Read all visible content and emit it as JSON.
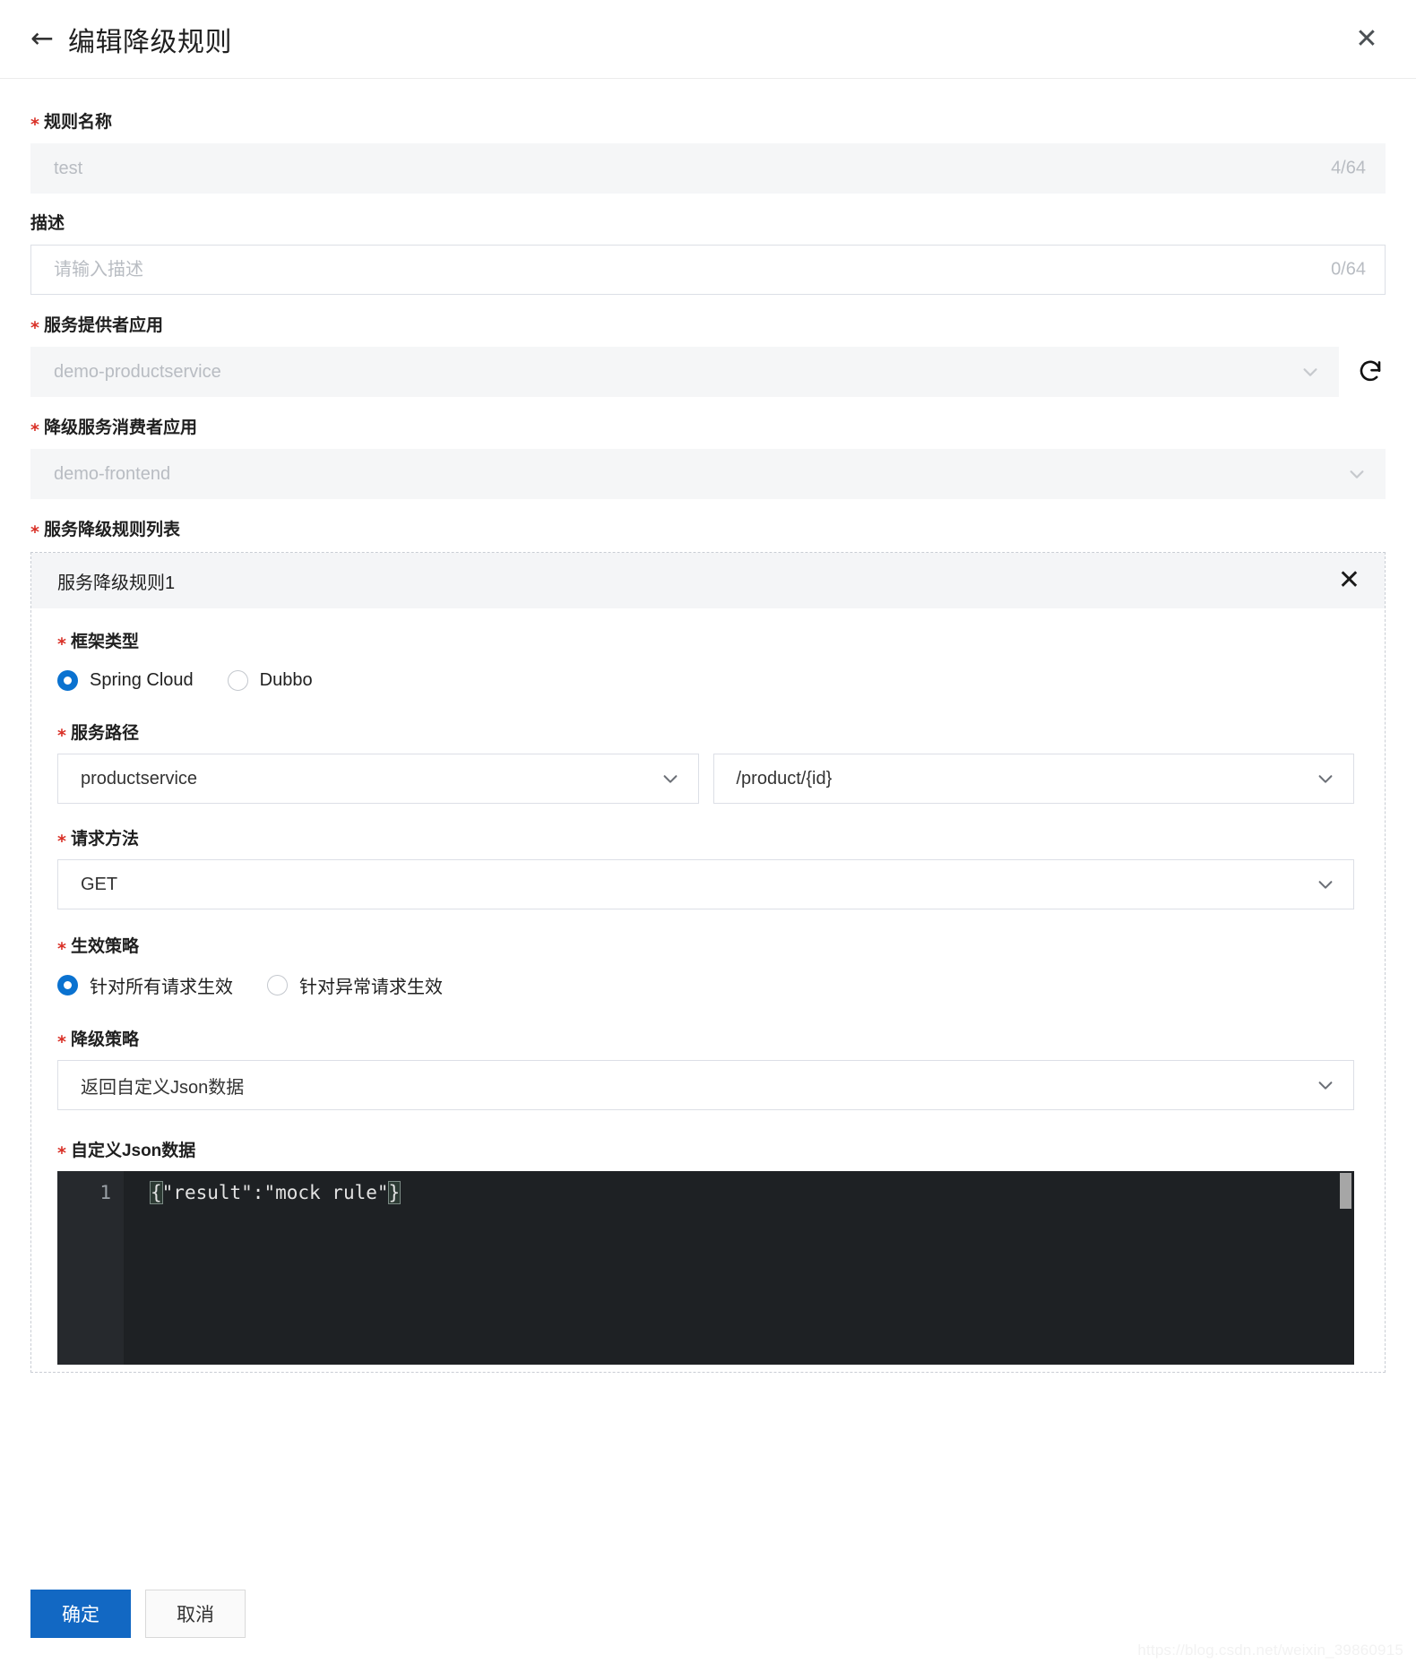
{
  "header": {
    "back_icon": "arrow-left-icon",
    "title": "编辑降级规则",
    "close_icon": "✕"
  },
  "form": {
    "rule_name": {
      "label": "规则名称",
      "required": true,
      "value": "test",
      "placeholder": "test",
      "counter": "4/64",
      "disabled": true
    },
    "description": {
      "label": "描述",
      "required": false,
      "value": "",
      "placeholder": "请输入描述",
      "counter": "0/64",
      "disabled": false
    },
    "provider_app": {
      "label": "服务提供者应用",
      "required": true,
      "value": "demo-productservice",
      "disabled": true,
      "refresh_icon": "refresh-icon"
    },
    "consumer_app": {
      "label": "降级服务消费者应用",
      "required": true,
      "value": "demo-frontend",
      "disabled": true
    },
    "rule_list": {
      "label": "服务降级规则列表",
      "required": true
    }
  },
  "rule_card": {
    "title": "服务降级规则1",
    "close_icon": "✕",
    "framework_type": {
      "label": "框架类型",
      "required": true,
      "options": [
        "Spring Cloud",
        "Dubbo"
      ],
      "selected": "Spring Cloud"
    },
    "service_path": {
      "label": "服务路径",
      "required": true,
      "service_value": "productservice",
      "path_value": "/product/{id}"
    },
    "request_method": {
      "label": "请求方法",
      "required": true,
      "value": "GET"
    },
    "effective_policy": {
      "label": "生效策略",
      "required": true,
      "options": [
        "针对所有请求生效",
        "针对异常请求生效"
      ],
      "selected": "针对所有请求生效"
    },
    "degrade_policy": {
      "label": "降级策略",
      "required": true,
      "value": "返回自定义Json数据"
    },
    "custom_json": {
      "label": "自定义Json数据",
      "required": true,
      "line_number": "1",
      "code_open_brace": "{",
      "code_middle": "\"result\":\"mock rule\"",
      "code_close_brace": "}"
    }
  },
  "footer": {
    "confirm_label": "确定",
    "cancel_label": "取消"
  },
  "watermark": "https://blog.csdn.net/weixin_39860915",
  "colors": {
    "primary": "#1268c3",
    "required_star": "#d93026",
    "radio_checked": "#0a72d0",
    "editor_bg": "#1e2124"
  }
}
